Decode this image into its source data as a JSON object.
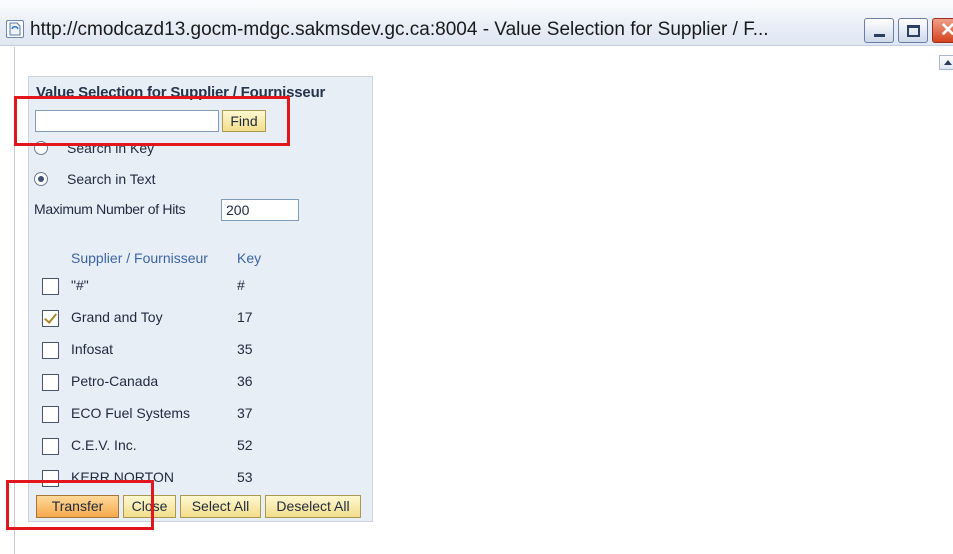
{
  "window": {
    "title": "http://cmodcazd13.gocm-mdgc.sakmsdev.gc.ca:8004 - Value Selection for Supplier / F...",
    "close_glyph": "✕"
  },
  "panel": {
    "title": "Value Selection for Supplier / Fournisseur",
    "search": {
      "value": "",
      "placeholder": ""
    },
    "find_label": "Find",
    "radio_key_label": "Search in Key",
    "radio_text_label": "Search in Text",
    "selected_search_mode": "text",
    "hits_label": "Maximum Number of Hits",
    "hits_value": "200",
    "columns": {
      "name": "Supplier / Fournisseur",
      "key": "Key"
    },
    "rows": [
      {
        "name": "\"#\"",
        "key": "#",
        "checked": false
      },
      {
        "name": "Grand and Toy",
        "key": "17",
        "checked": true
      },
      {
        "name": "Infosat",
        "key": "35",
        "checked": false
      },
      {
        "name": "Petro-Canada",
        "key": "36",
        "checked": false
      },
      {
        "name": "ECO Fuel Systems",
        "key": "37",
        "checked": false
      },
      {
        "name": "C.E.V. Inc.",
        "key": "52",
        "checked": false
      },
      {
        "name": "KERR NORTON",
        "key": "53",
        "checked": false
      }
    ],
    "buttons": {
      "transfer": "Transfer",
      "close": "Close",
      "select_all": "Select All",
      "deselect_all": "Deselect All"
    }
  },
  "colors": {
    "highlight": "#e3161d",
    "panel_bg": "#e8eef5",
    "button_bg": "#f2dd8a",
    "column_header": "#3b64a8"
  }
}
